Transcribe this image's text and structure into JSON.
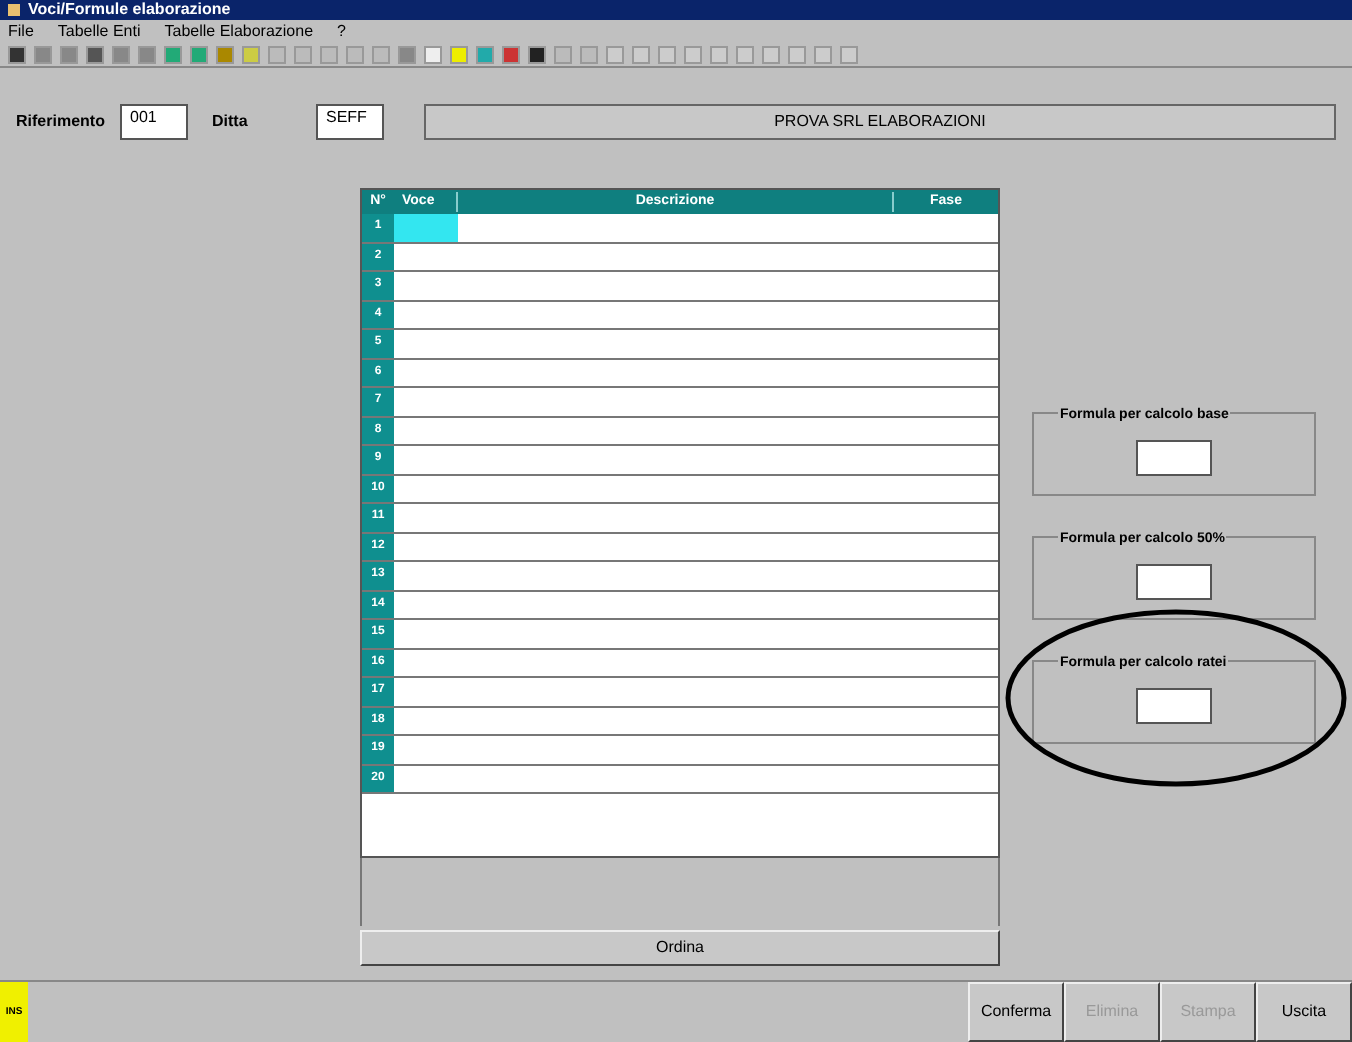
{
  "window": {
    "title": "Voci/Formule elaborazione"
  },
  "menu": [
    "File",
    "Tabelle Enti",
    "Tabelle Elaborazione",
    "?"
  ],
  "header": {
    "fields": [
      {
        "label": "Riferimento",
        "value": "001"
      },
      {
        "label": "Ditta",
        "value": "SEFF"
      }
    ],
    "banner": "PROVA SRL ELABORAZIONI"
  },
  "table": {
    "columns": [
      "N°",
      "Voce",
      "Descrizione",
      "Fase"
    ],
    "rows": [
      {
        "number": "1",
        "selected": true
      },
      {
        "number": "2",
        "selected": false
      },
      {
        "number": "3",
        "selected": false
      },
      {
        "number": "4",
        "selected": false
      },
      {
        "number": "5",
        "selected": false
      },
      {
        "number": "6",
        "selected": false
      },
      {
        "number": "7",
        "selected": false
      },
      {
        "number": "8",
        "selected": false
      },
      {
        "number": "9",
        "selected": false
      },
      {
        "number": "10",
        "selected": false
      },
      {
        "number": "11",
        "selected": false
      },
      {
        "number": "12",
        "selected": false
      },
      {
        "number": "13",
        "selected": false
      },
      {
        "number": "14",
        "selected": false
      },
      {
        "number": "15",
        "selected": false
      },
      {
        "number": "16",
        "selected": false
      },
      {
        "number": "17",
        "selected": false
      },
      {
        "number": "18",
        "selected": false
      },
      {
        "number": "19",
        "selected": false
      },
      {
        "number": "20",
        "selected": false
      }
    ]
  },
  "order_button": "Ordina",
  "formula_groups": [
    {
      "label": "Formula per calcolo base",
      "highlighted": false
    },
    {
      "label": "Formula per calcolo 50%",
      "highlighted": false
    },
    {
      "label": "Formula per calcolo ratei",
      "highlighted": true
    }
  ],
  "status_badge": "INS",
  "buttons": [
    {
      "label": "Conferma",
      "disabled": false
    },
    {
      "label": "Elimina",
      "disabled": true
    },
    {
      "label": "Stampa",
      "disabled": true
    },
    {
      "label": "Uscita",
      "disabled": false
    }
  ]
}
